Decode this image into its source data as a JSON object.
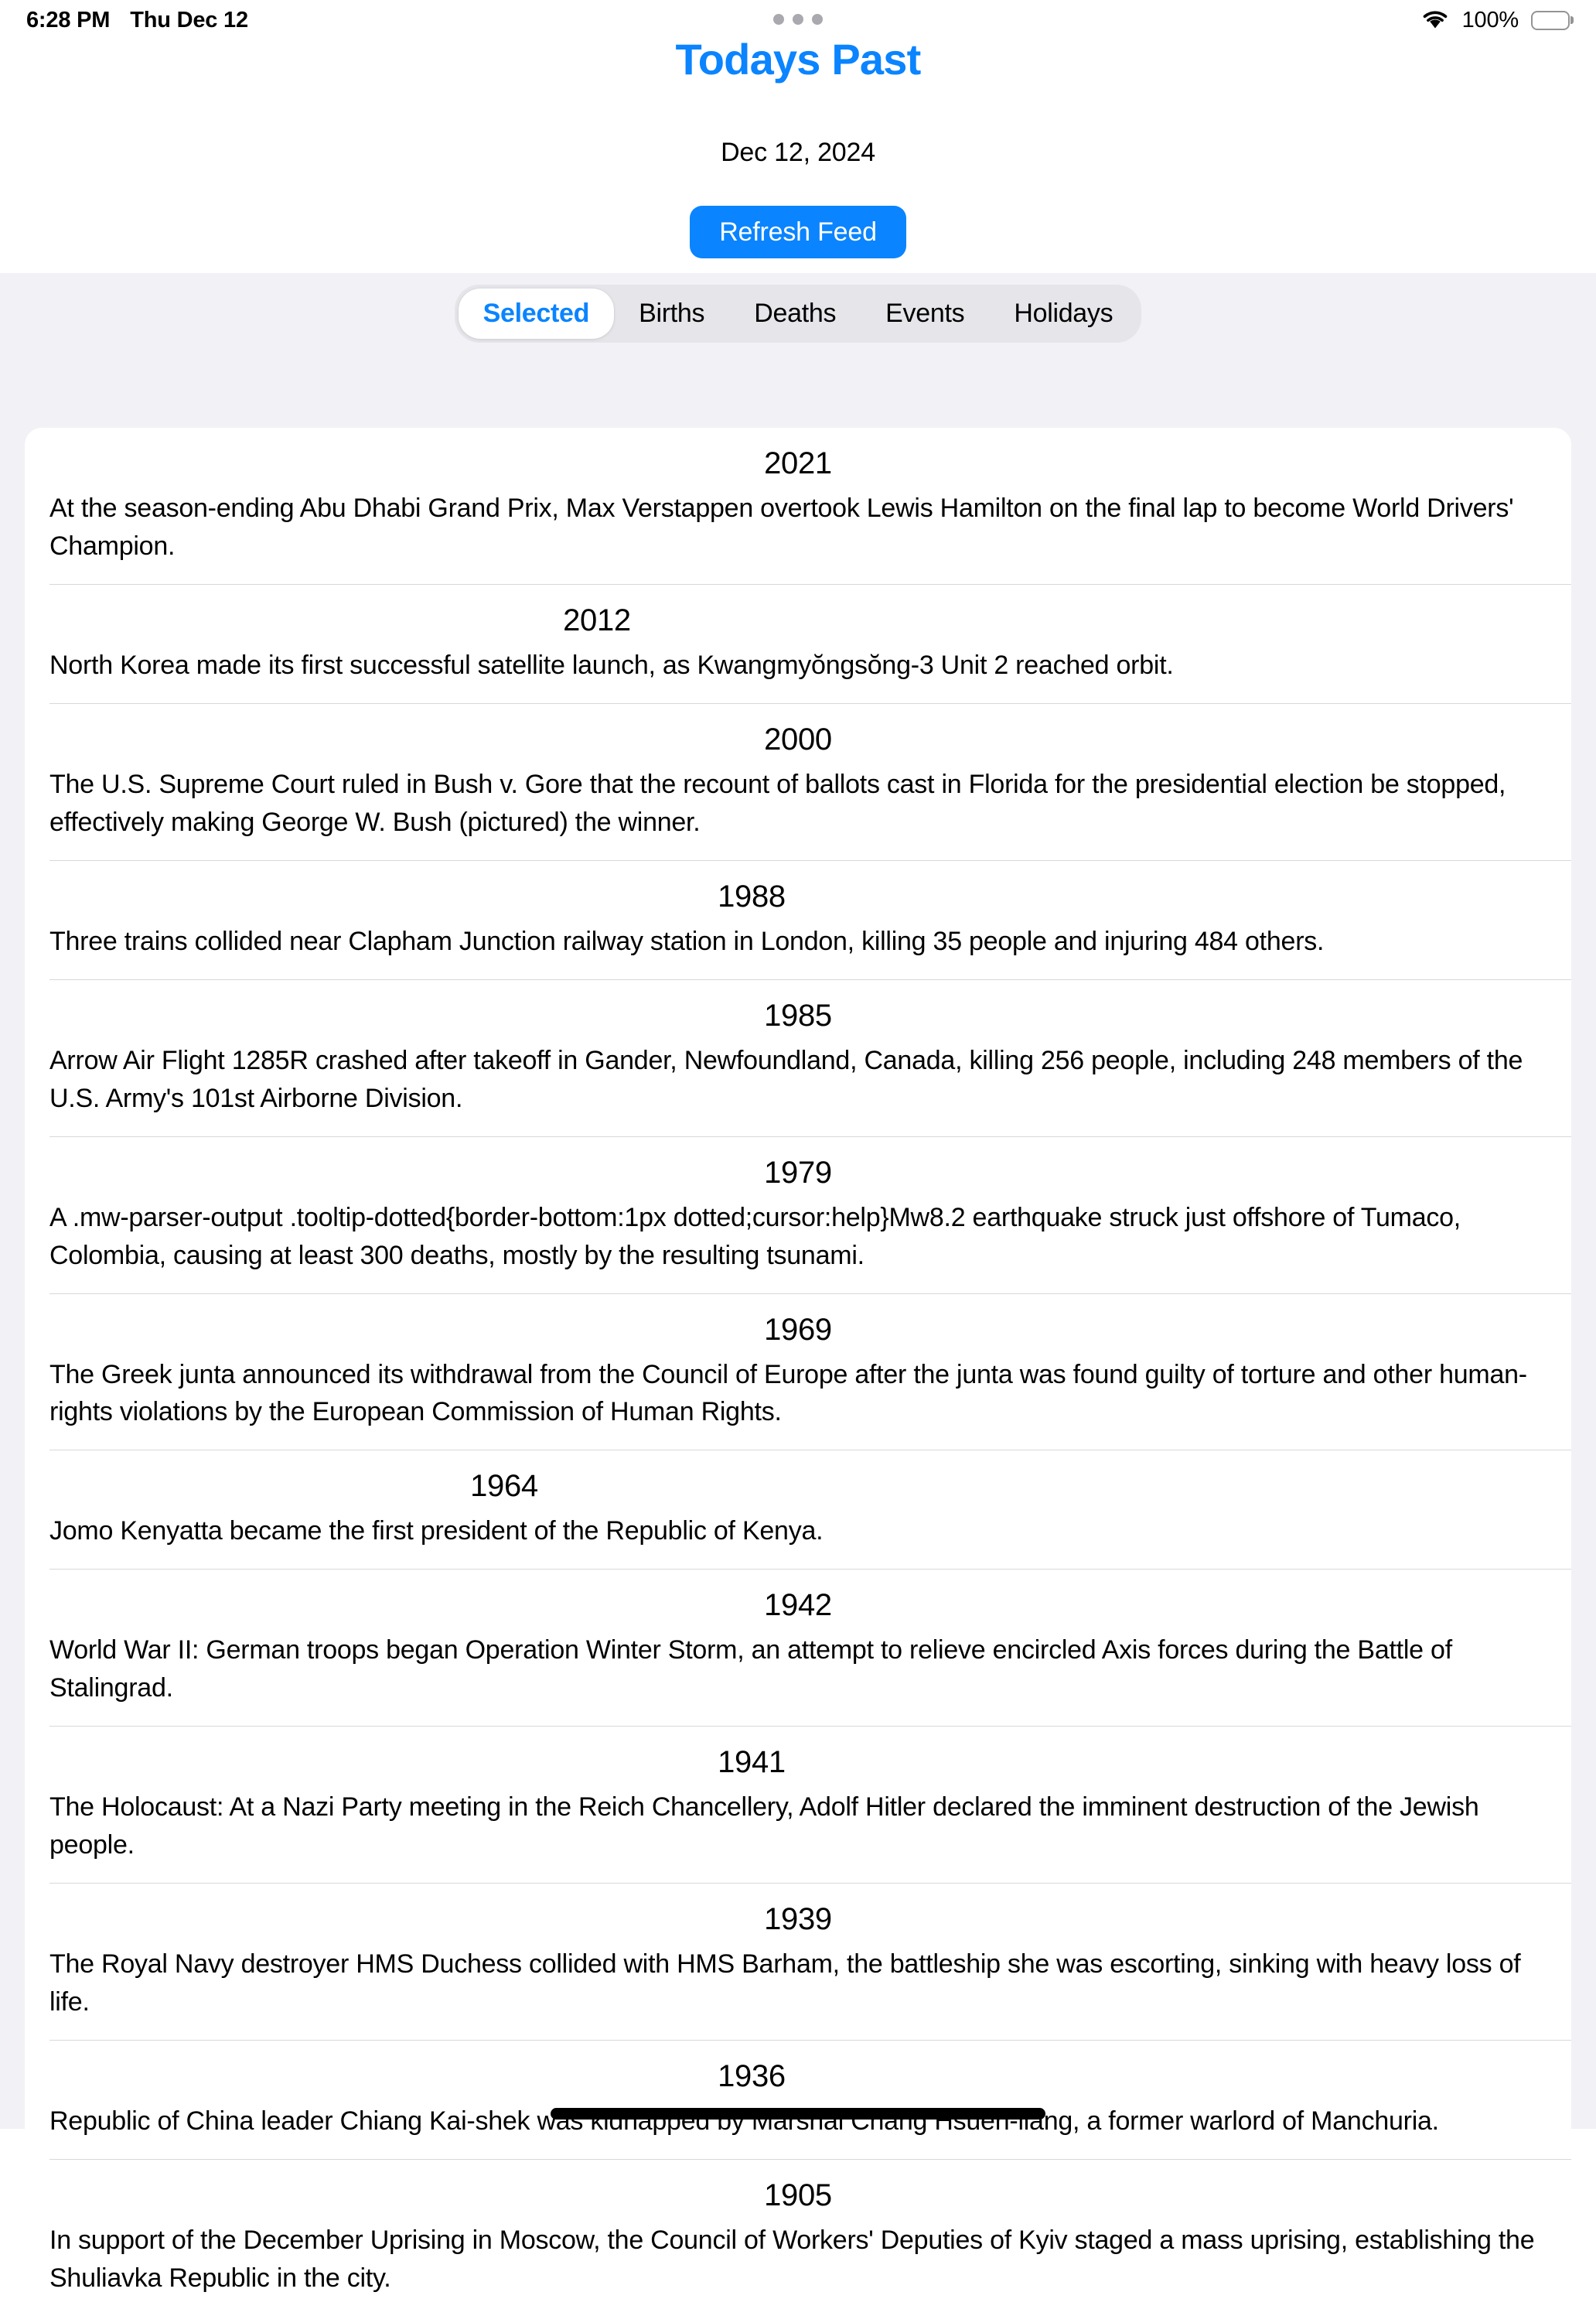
{
  "status_bar": {
    "time": "6:28 PM",
    "date": "Thu Dec 12",
    "battery_percent": "100%",
    "wifi_icon": "wifi-icon",
    "battery_icon": "battery-full-icon"
  },
  "header": {
    "title": "Todays Past",
    "date": "Dec 12, 2024",
    "refresh_label": "Refresh Feed",
    "accent_color": "#0a84ff"
  },
  "segmented_control": {
    "selected_index": 0,
    "items": [
      {
        "label": "Selected",
        "active": true
      },
      {
        "label": "Births",
        "active": false
      },
      {
        "label": "Deaths",
        "active": false
      },
      {
        "label": "Events",
        "active": false
      },
      {
        "label": "Holidays",
        "active": false
      }
    ]
  },
  "feed": {
    "entries": [
      {
        "year": "2021",
        "text": "At the season-ending Abu Dhabi Grand Prix, Max Verstappen overtook Lewis Hamilton on the final lap to become World Drivers' Champion.",
        "width_class": "w-100"
      },
      {
        "year": "2012",
        "text": "North Korea made its first successful satellite launch, as Kwangmyŏngsŏng-3 Unit 2 reached orbit.",
        "width_class": "w-70"
      },
      {
        "year": "2000",
        "text": "The U.S. Supreme Court ruled in Bush v. Gore that the recount of ballots cast in Florida for the presidential election be stopped, effectively making George W. Bush (pictured) the winner.",
        "width_class": "w-100"
      },
      {
        "year": "1988",
        "text": "Three trains collided near Clapham Junction railway station in London, killing 35 people and injuring 484 others.",
        "width_class": "w-90"
      },
      {
        "year": "1985",
        "text": "Arrow Air Flight 1285R crashed after takeoff in Gander, Newfoundland, Canada, killing 256 people, including 248 members of the U.S. Army's 101st Airborne Division.",
        "width_class": "w-100"
      },
      {
        "year": "1979",
        "text": "A .mw-parser-output .tooltip-dotted{border-bottom:1px dotted;cursor:help}Mw8.2 earthquake struck just offshore of Tumaco, Colombia, causing at least 300 deaths, mostly by the resulting tsunami.",
        "width_class": "w-100"
      },
      {
        "year": "1969",
        "text": "The Greek junta announced its withdrawal from the Council of Europe after the junta was found guilty of torture and other human-rights violations by the European Commission of Human Rights.",
        "width_class": "w-100"
      },
      {
        "year": "1964",
        "text": "Jomo Kenyatta became the first president of the Republic of Kenya.",
        "width_class": "w-60"
      },
      {
        "year": "1942",
        "text": "World War II: German troops began Operation Winter Storm, an attempt to relieve encircled Axis forces during the Battle of Stalingrad.",
        "width_class": "w-100"
      },
      {
        "year": "1941",
        "text": "The Holocaust: At a Nazi Party meeting in the Reich Chancellery, Adolf Hitler declared the imminent destruction of the Jewish people.",
        "width_class": "w-90"
      },
      {
        "year": "1939",
        "text": "The Royal Navy destroyer HMS Duchess collided with HMS Barham, the battleship she was escorting, sinking with heavy loss of life.",
        "width_class": "w-100"
      },
      {
        "year": "1936",
        "text": "Republic of China leader Chiang Kai-shek was kidnapped by Marshal Chang Hsueh-liang, a former warlord of Manchuria.",
        "width_class": "w-90"
      },
      {
        "year": "1905",
        "text": "In support of the December Uprising in Moscow, the Council of Workers' Deputies of Kyiv staged a mass uprising, establishing the Shuliavka Republic in the city.",
        "width_class": "w-100"
      }
    ]
  }
}
